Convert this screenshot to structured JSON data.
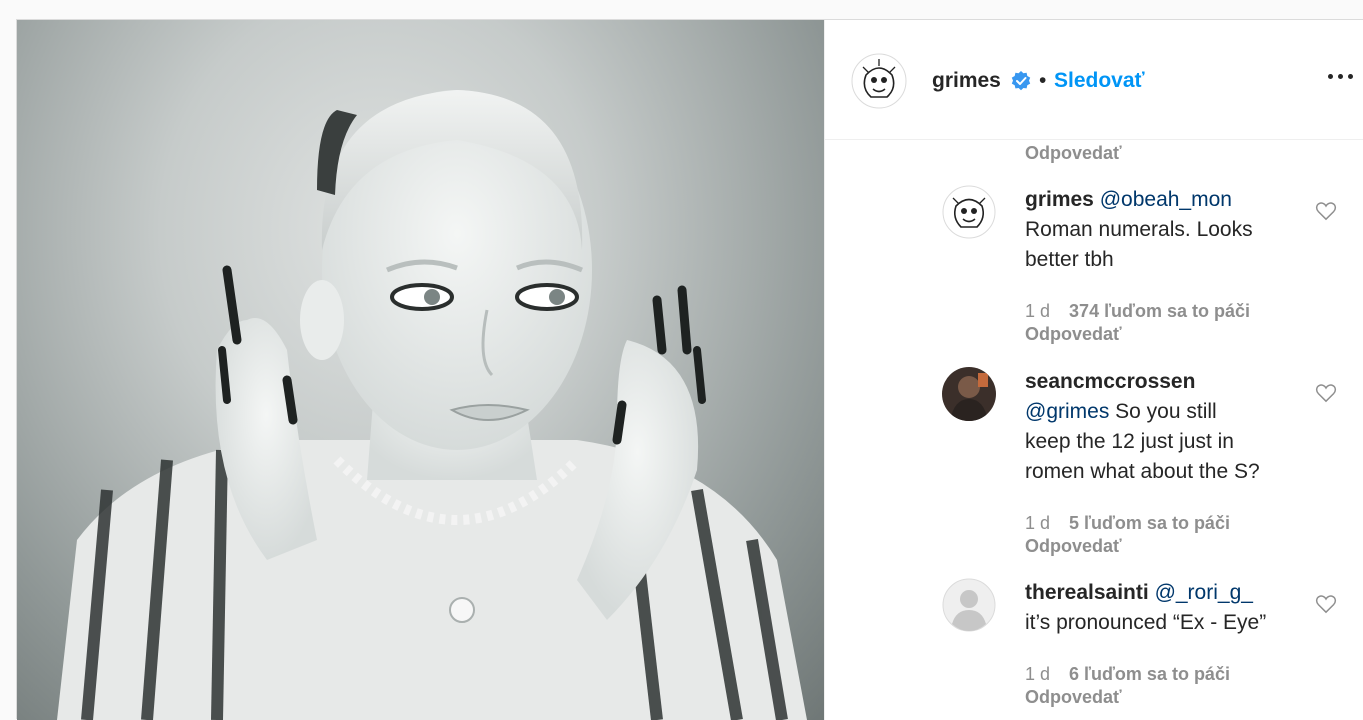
{
  "header": {
    "username": "grimes",
    "separator": "•",
    "follow_label": "Sledovať"
  },
  "top_reply_label": "Odpovedať",
  "comments": [
    {
      "username": "grimes",
      "mention": "@obeah_mon",
      "text_line1": "Roman numerals. Looks",
      "text_line2": "better tbh",
      "time": "1 d",
      "likes": "374 ľuďom sa to páči",
      "reply_label": "Odpovedať"
    },
    {
      "username": "seancmccrossen",
      "mention": "@grimes",
      "text_line1": " So you still",
      "text_line2": "keep the 12 just just in",
      "text_line3": "romen what about the S?",
      "time": "1 d",
      "likes": "5 ľuďom sa to páči",
      "reply_label": "Odpovedať"
    },
    {
      "username": "therealsainti",
      "mention": "@_rori_g_",
      "text_line1": "it’s pronounced “Ex - Eye”",
      "time": "1 d",
      "likes": "6 ľuďom sa to páči",
      "reply_label": "Odpovedať"
    }
  ],
  "icons": {
    "verified": "verified-badge-icon",
    "more": "more-options-icon",
    "like": "heart-outline-icon"
  },
  "colors": {
    "link_blue": "#0095f6",
    "mention_blue": "#00376b",
    "secondary_text": "#8e8e8e",
    "verified_blue": "#3897f0"
  }
}
